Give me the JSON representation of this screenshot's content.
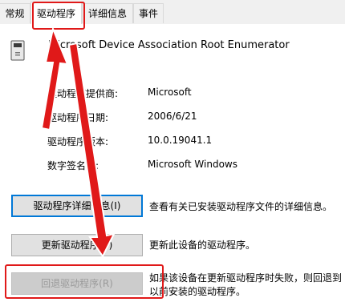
{
  "tabs": [
    {
      "label": "常规"
    },
    {
      "label": "驱动程序"
    },
    {
      "label": "详细信息"
    },
    {
      "label": "事件"
    }
  ],
  "device": {
    "name": "Microsoft Device Association Root Enumerator",
    "icon": "device-icon"
  },
  "properties": [
    {
      "label": "驱动程序提供商:",
      "value": "Microsoft"
    },
    {
      "label": "驱动程序日期:",
      "value": "2006/6/21"
    },
    {
      "label": "驱动程序版本:",
      "value": "10.0.19041.1"
    },
    {
      "label": "数字签名者:",
      "value": "Microsoft Windows"
    }
  ],
  "actions": [
    {
      "button": "驱动程序详细信息(I)",
      "description": "查看有关已安装驱动程序文件的详细信息。"
    },
    {
      "button": "更新驱动程序(P)",
      "description": "更新此设备的驱动程序。"
    },
    {
      "button": "回退驱动程序(R)",
      "description_line1": "如果该设备在更新驱动程序时失败，则回退到",
      "description_line2": "以前安装的驱动程序。"
    }
  ],
  "annotation_color": "#e01919"
}
